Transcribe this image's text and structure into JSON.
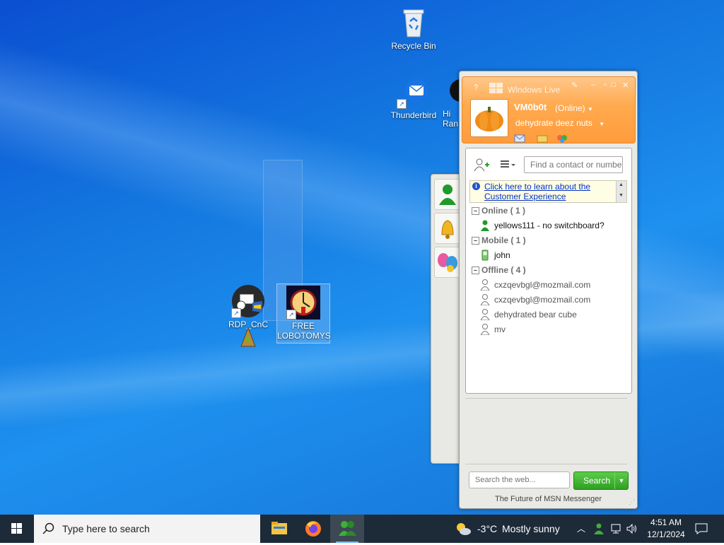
{
  "desktop": {
    "icons": [
      {
        "id": "recycle-bin",
        "label": "Recycle Bin"
      },
      {
        "id": "thunderbird",
        "label": "Thunderbird"
      },
      {
        "id": "partial",
        "label": "Hi\nRan"
      },
      {
        "id": "rdp-cnc",
        "label": "RDP_CnC"
      },
      {
        "id": "free-lobotomys",
        "label": "FREE\nLOBOTOMYS"
      }
    ]
  },
  "msn": {
    "window_title": "Windows Live",
    "user": {
      "name": "VM0b0t",
      "status": "(Online)",
      "personal_message": "dehydrate deez nuts"
    },
    "search_placeholder": "Find a contact or number",
    "info_bar": "Click here to learn about the Customer Experience",
    "groups": [
      {
        "label": "Online ( 1 )",
        "contacts": [
          {
            "name": "yellows111 - no switchboard?",
            "status": "online"
          }
        ]
      },
      {
        "label": "Mobile ( 1 )",
        "contacts": [
          {
            "name": "john",
            "status": "mobile"
          }
        ]
      },
      {
        "label": "Offline ( 4 )",
        "contacts": [
          {
            "name": "cxzqevbgl@mozmail.com",
            "status": "offline"
          },
          {
            "name": "cxzqevbgl@mozmail.com",
            "status": "offline"
          },
          {
            "name": "dehydrated bear cube",
            "status": "offline"
          },
          {
            "name": "mv",
            "status": "offline"
          }
        ]
      }
    ],
    "web_search_placeholder": "Search the web...",
    "search_button": "Search",
    "footer": "The Future of MSN Messenger"
  },
  "taskbar": {
    "search_placeholder": "Type here to search",
    "weather": {
      "temp": "-3°C",
      "desc": "Mostly sunny"
    },
    "time": "4:51 AM",
    "date": "12/1/2024"
  },
  "colors": {
    "msn_orange": "#ffa94d",
    "search_green": "#2f9f22",
    "taskbar": "#1d2a38"
  }
}
